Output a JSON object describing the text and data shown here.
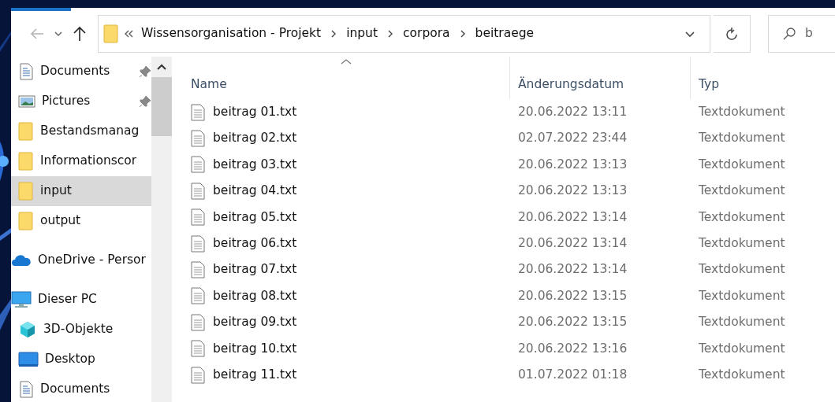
{
  "navigation": {
    "back_disabled": true
  },
  "address_bar": {
    "crumbs": [
      "Wissensorganisation - Projekt",
      "input",
      "corpora",
      "beitraege"
    ]
  },
  "search": {
    "placeholder": "b"
  },
  "sidebar": {
    "quick_access": [
      {
        "label": "Documents",
        "kind": "document",
        "pinned": true,
        "selected": false
      },
      {
        "label": "Pictures",
        "kind": "picture",
        "pinned": true,
        "selected": false
      },
      {
        "label": "Bestandsmanag",
        "kind": "folder",
        "pinned": false,
        "selected": false
      },
      {
        "label": "Informationscor",
        "kind": "folder",
        "pinned": false,
        "selected": false
      },
      {
        "label": "input",
        "kind": "folder",
        "pinned": false,
        "selected": true
      },
      {
        "label": "output",
        "kind": "folder",
        "pinned": false,
        "selected": false
      }
    ],
    "onedrive": {
      "label": "OneDrive - Persor"
    },
    "this_pc": {
      "label": "Dieser PC",
      "children": [
        {
          "label": "3D-Objekte",
          "kind": "cube"
        },
        {
          "label": "Desktop",
          "kind": "desktop"
        },
        {
          "label": "Documents",
          "kind": "document"
        }
      ]
    }
  },
  "table": {
    "columns": [
      "Name",
      "Änderungsdatum",
      "Typ"
    ],
    "rows": [
      {
        "name": "beitrag 01.txt",
        "date": "20.06.2022 13:11",
        "type": "Textdokument"
      },
      {
        "name": "beitrag 02.txt",
        "date": "02.07.2022 23:44",
        "type": "Textdokument"
      },
      {
        "name": "beitrag 03.txt",
        "date": "20.06.2022 13:13",
        "type": "Textdokument"
      },
      {
        "name": "beitrag 04.txt",
        "date": "20.06.2022 13:13",
        "type": "Textdokument"
      },
      {
        "name": "beitrag 05.txt",
        "date": "20.06.2022 13:14",
        "type": "Textdokument"
      },
      {
        "name": "beitrag 06.txt",
        "date": "20.06.2022 13:14",
        "type": "Textdokument"
      },
      {
        "name": "beitrag 07.txt",
        "date": "20.06.2022 13:14",
        "type": "Textdokument"
      },
      {
        "name": "beitrag 08.txt",
        "date": "20.06.2022 13:15",
        "type": "Textdokument"
      },
      {
        "name": "beitrag 09.txt",
        "date": "20.06.2022 13:15",
        "type": "Textdokument"
      },
      {
        "name": "beitrag 10.txt",
        "date": "20.06.2022 13:16",
        "type": "Textdokument"
      },
      {
        "name": "beitrag 11.txt",
        "date": "01.07.2022 01:18",
        "type": "Textdokument"
      }
    ]
  }
}
